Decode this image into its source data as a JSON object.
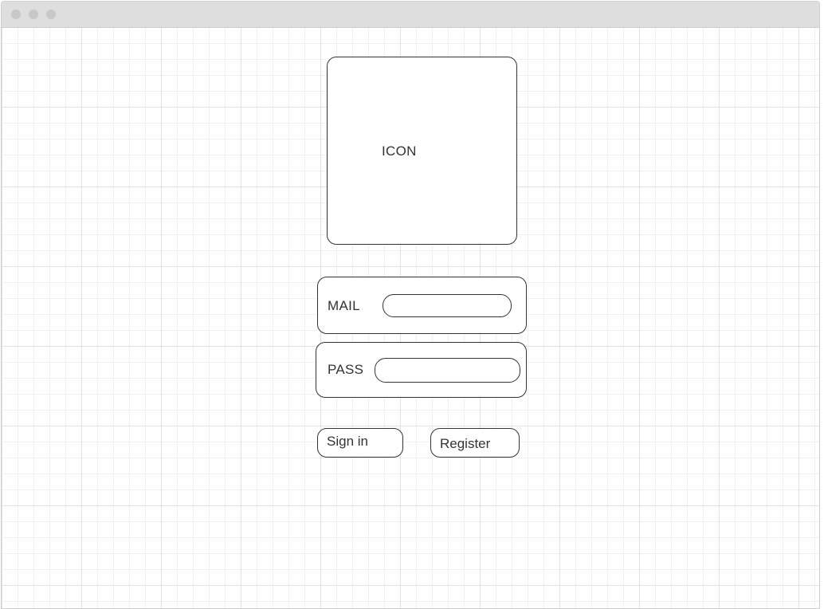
{
  "icon_placeholder": {
    "label": "ICON"
  },
  "login_form": {
    "mail": {
      "label": "MAIL",
      "value": "",
      "placeholder": ""
    },
    "pass": {
      "label": "PASS",
      "value": "",
      "placeholder": ""
    }
  },
  "buttons": {
    "sign_in": "Sign in",
    "register": "Register"
  }
}
